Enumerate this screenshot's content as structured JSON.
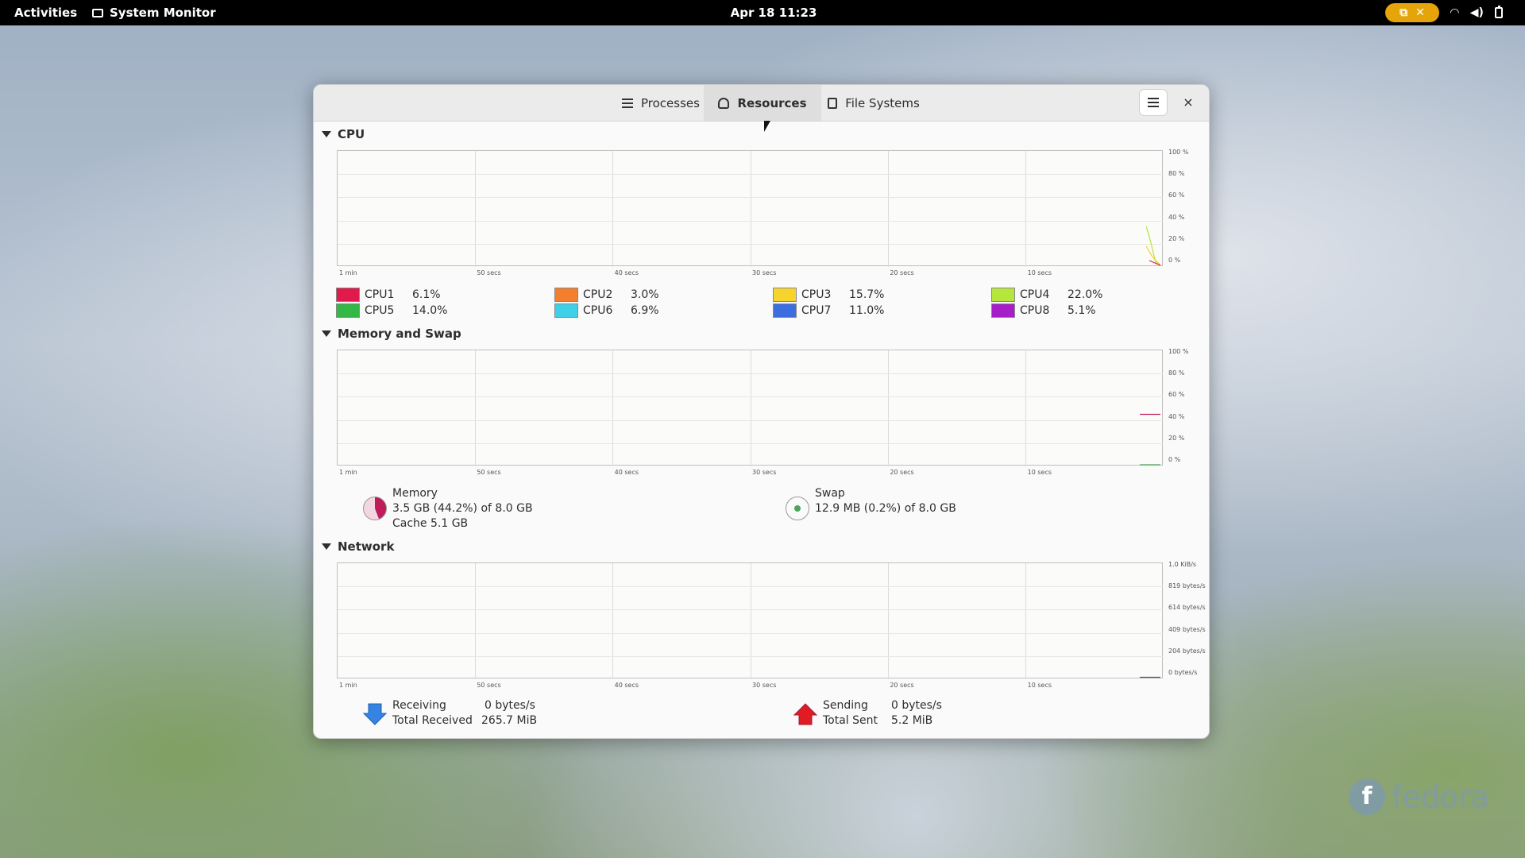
{
  "topbar": {
    "activities": "Activities",
    "app_name": "System Monitor",
    "clock": "Apr 18  11:23",
    "indicator_close": "✕"
  },
  "window": {
    "tabs": [
      {
        "label": "Processes",
        "icon": "list-icon",
        "active": false
      },
      {
        "label": "Resources",
        "icon": "gauge-icon",
        "active": true
      },
      {
        "label": "File Systems",
        "icon": "disk-icon",
        "active": false
      }
    ],
    "close_label": "×"
  },
  "cpu": {
    "title": "CPU",
    "y_ticks": [
      "100 %",
      "80 %",
      "60 %",
      "40 %",
      "20 %",
      "0 %"
    ],
    "x_ticks": [
      "1 min",
      "50 secs",
      "40 secs",
      "30 secs",
      "20 secs",
      "10 secs"
    ],
    "cores": [
      {
        "name": "CPU1",
        "value": "6.1%",
        "color": "#e01b4c"
      },
      {
        "name": "CPU2",
        "value": "3.0%",
        "color": "#f37f2e"
      },
      {
        "name": "CPU3",
        "value": "15.7%",
        "color": "#f6d32d"
      },
      {
        "name": "CPU4",
        "value": "22.0%",
        "color": "#b5e63c"
      },
      {
        "name": "CPU5",
        "value": "14.0%",
        "color": "#33b845"
      },
      {
        "name": "CPU6",
        "value": "6.9%",
        "color": "#3fd0e8"
      },
      {
        "name": "CPU7",
        "value": "11.0%",
        "color": "#3d6ee0"
      },
      {
        "name": "CPU8",
        "value": "5.1%",
        "color": "#a51ec8"
      }
    ]
  },
  "memory": {
    "title": "Memory and Swap",
    "y_ticks": [
      "100 %",
      "80 %",
      "60 %",
      "40 %",
      "20 %",
      "0 %"
    ],
    "x_ticks": [
      "1 min",
      "50 secs",
      "40 secs",
      "30 secs",
      "20 secs",
      "10 secs"
    ],
    "memory_label": "Memory",
    "memory_usage": "3.5 GB (44.2%) of 8.0 GB",
    "memory_cache": "Cache 5.1 GB",
    "memory_fraction": 0.442,
    "memory_color": "#c01c5b",
    "swap_label": "Swap",
    "swap_usage": "12.9 MB (0.2%) of 8.0 GB",
    "swap_color": "#4aa55a"
  },
  "network": {
    "title": "Network",
    "y_ticks": [
      "1.0 KiB/s",
      "819 bytes/s",
      "614 bytes/s",
      "409 bytes/s",
      "204 bytes/s",
      "0 bytes/s"
    ],
    "x_ticks": [
      "1 min",
      "50 secs",
      "40 secs",
      "30 secs",
      "20 secs",
      "10 secs"
    ],
    "receiving_label": "Receiving",
    "receiving_value": "0 bytes/s",
    "total_received_label": "Total Received",
    "total_received_value": "265.7 MiB",
    "sending_label": "Sending",
    "sending_value": "0 bytes/s",
    "total_sent_label": "Total Sent",
    "total_sent_value": "5.2 MiB",
    "receive_color": "#3584e4",
    "send_color": "#e01b24"
  },
  "desktop": {
    "logo_text": "fedora"
  }
}
